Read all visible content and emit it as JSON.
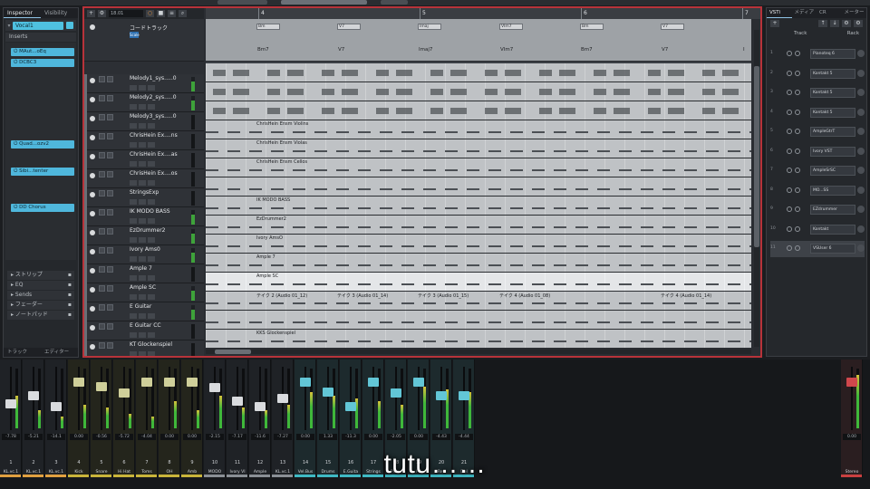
{
  "inspector": {
    "tabs": [
      "Inspector",
      "Visibility"
    ],
    "track_name": "Vocal1",
    "inserts_label": "Inserts",
    "inserts": [
      "MAut...oEq",
      "DCBC3",
      "Quad...ozv2",
      "Sibi...tenter",
      "DD Chorus"
    ],
    "sections": [
      "ストリップ",
      "EQ",
      "Sends",
      "フェーダー",
      "ノートパッド"
    ],
    "footer_tabs": [
      "トラック",
      "エディター"
    ]
  },
  "toolbar": {
    "position_display": "18.01"
  },
  "ruler": {
    "bars": [
      "4",
      "5",
      "6",
      "7"
    ]
  },
  "chord_track": {
    "name": "コードトラック",
    "tag": "Scale",
    "events": [
      "Bm7",
      "V7",
      "Imaj7",
      "VIm7",
      "Bm7",
      "V7",
      "I"
    ],
    "boxes": [
      "Bm",
      "V7",
      "Imaj",
      "VIm7",
      "Bm",
      "V7"
    ]
  },
  "tracks": [
    {
      "name": "Melody1_sys.....0",
      "color": "#6a6f76",
      "kind": "wave",
      "meter": true
    },
    {
      "name": "Melody2_sys.....0",
      "color": "#6a6f76",
      "kind": "wave",
      "meter": true
    },
    {
      "name": "Melody3_sys.....0",
      "color": "#6a6f76",
      "kind": "wave",
      "meter": false
    },
    {
      "name": "ChrisHein Ex....ns",
      "color": "#6a6f76",
      "kind": "midi",
      "region": "ChrisHein Ensm Violins",
      "meter": false
    },
    {
      "name": "ChrisHein Ex....as",
      "color": "#6a6f76",
      "kind": "midi",
      "region": "ChrisHein Ensm Violas",
      "meter": false
    },
    {
      "name": "ChrisHein Ex....os",
      "color": "#6a6f76",
      "kind": "midi",
      "region": "ChrisHein Ensm Cellos",
      "meter": false
    },
    {
      "name": "StringsExp",
      "color": "#6a6f76",
      "kind": "midi",
      "region": "",
      "meter": false
    },
    {
      "name": "IK MODO BASS",
      "color": "#6a6f76",
      "kind": "midi",
      "region": "IK MODO BASS",
      "meter": true
    },
    {
      "name": "EzDrummer2",
      "color": "#6a6f76",
      "kind": "midi",
      "region": "EzDrummer2",
      "meter": true
    },
    {
      "name": "Ivory Ams0",
      "color": "#6a6f76",
      "kind": "midi",
      "region": "Ivory AmsO",
      "meter": true
    },
    {
      "name": "Ample 7",
      "color": "#6a6f76",
      "kind": "midi",
      "region": "Ample 7",
      "meter": false
    },
    {
      "name": "Ample SC",
      "color": "#6a6f76",
      "kind": "midi",
      "region": "Ample SC",
      "meter": true,
      "selected": true
    },
    {
      "name": "E Guitar",
      "color": "#6a6f76",
      "kind": "takes",
      "meter": true
    },
    {
      "name": "E Guitar CC",
      "color": "#6a6f76",
      "kind": "midi",
      "region": "",
      "meter": false
    },
    {
      "name": "KT Glockenspiel",
      "color": "#6a6f76",
      "kind": "midi",
      "region": "KKS Glockenspiel",
      "meter": false
    }
  ],
  "takes": [
    "テイク 2 (Audio 01_12)",
    "テイク 3 (Audio 01_14)",
    "テイク 3 (Audio 01_15)",
    "テイク 4 (Audio 01_08)",
    "テイク 4 (Audio 01_14)"
  ],
  "rack": {
    "tabs": [
      "VSTi",
      "メディア",
      "CR",
      "メーター"
    ],
    "col_track": "Track",
    "col_rack": "Rack",
    "slots": [
      "Pianoteq 6",
      "Kontakt 5",
      "Kontakt 5",
      "Kontakt 5",
      "AmpleGtrT",
      "Ivory VST",
      "AmpleSrSC",
      "MO...SS",
      "EZdrummer",
      "Kontakt",
      "VSUser 6"
    ]
  },
  "mixer": {
    "strips": [
      {
        "num": "1",
        "label": "KL.vc.1",
        "val": "-7.78",
        "color": "#6b7077",
        "fader": 0.4,
        "level": 0.55,
        "foot": "#e0a040"
      },
      {
        "num": "2",
        "label": "KL.vc.1",
        "val": "-5.21",
        "color": "#6b7077",
        "fader": 0.55,
        "level": 0.3,
        "foot": "#e0a040"
      },
      {
        "num": "3",
        "label": "KL.vc.1",
        "val": "-14.1",
        "color": "#6b7077",
        "fader": 0.35,
        "level": 0.2,
        "foot": "#e0a040"
      },
      {
        "num": "4",
        "label": "Kick",
        "val": "0.00",
        "color": "#7a7b42",
        "fader": 0.8,
        "level": 0.4,
        "foot": "#c9b43a"
      },
      {
        "num": "5",
        "label": "Snare",
        "val": "-0.56",
        "color": "#7a7b42",
        "fader": 0.72,
        "level": 0.35,
        "foot": "#c9b43a"
      },
      {
        "num": "6",
        "label": "Hi Hat",
        "val": "-5.72",
        "color": "#7a7b42",
        "fader": 0.6,
        "level": 0.25,
        "foot": "#c9b43a"
      },
      {
        "num": "7",
        "label": "Toms",
        "val": "-4.04",
        "color": "#7a7b42",
        "fader": 0.8,
        "level": 0.2,
        "foot": "#c9b43a"
      },
      {
        "num": "8",
        "label": "OH",
        "val": "0.00",
        "color": "#7a7b42",
        "fader": 0.8,
        "level": 0.45,
        "foot": "#c9b43a"
      },
      {
        "num": "9",
        "label": "Amb",
        "val": "0.00",
        "color": "#7a7b42",
        "fader": 0.8,
        "level": 0.3,
        "foot": "#c9b43a"
      },
      {
        "num": "10",
        "label": "MODO",
        "val": "-2.15",
        "color": "#6b7077",
        "fader": 0.7,
        "level": 0.55,
        "foot": "#8a8f95"
      },
      {
        "num": "11",
        "label": "Ivory VI",
        "val": "-7.17",
        "color": "#6b7077",
        "fader": 0.45,
        "level": 0.35,
        "foot": "#8a8f95"
      },
      {
        "num": "12",
        "label": "Ample",
        "val": "-11.6",
        "color": "#6b7077",
        "fader": 0.35,
        "level": 0.3,
        "foot": "#8a8f95"
      },
      {
        "num": "13",
        "label": "KL.vc.1",
        "val": "-7.27",
        "color": "#6b7077",
        "fader": 0.5,
        "level": 0.4,
        "foot": "#8a8f95"
      },
      {
        "num": "14",
        "label": "Vel.Bus",
        "val": "0.00",
        "color": "#3a7c86",
        "fader": 0.8,
        "level": 0.6,
        "foot": "#3fb9c4"
      },
      {
        "num": "15",
        "label": "Drums",
        "val": "1.33",
        "color": "#3a7c86",
        "fader": 0.62,
        "level": 0.55,
        "foot": "#3fb9c4"
      },
      {
        "num": "16",
        "label": "E.Guita",
        "val": "-11.3",
        "color": "#3a7c86",
        "fader": 0.35,
        "level": 0.5,
        "foot": "#3fb9c4"
      },
      {
        "num": "17",
        "label": "Strings",
        "val": "0.00",
        "color": "#3a7c86",
        "fader": 0.8,
        "level": 0.45,
        "foot": "#3fb9c4"
      },
      {
        "num": "18",
        "label": "Piano",
        "val": "-2.05",
        "color": "#3a7c86",
        "fader": 0.6,
        "level": 0.4,
        "foot": "#3fb9c4"
      },
      {
        "num": "19",
        "label": "FX",
        "val": "0.00",
        "color": "#3a7c86",
        "fader": 0.8,
        "level": 0.7,
        "foot": "#3fb9c4"
      },
      {
        "num": "20",
        "label": "Rev",
        "val": "-4.43",
        "color": "#3a7c86",
        "fader": 0.55,
        "level": 0.65,
        "foot": "#3fb9c4"
      },
      {
        "num": "21",
        "label": "Del",
        "val": "-4.44",
        "color": "#3a7c86",
        "fader": 0.55,
        "level": 0.6,
        "foot": "#3fb9c4"
      }
    ],
    "master": {
      "label": "Stereo",
      "val": "0.00",
      "color": "#8a2a2e",
      "fader": 0.8,
      "level": 0.9,
      "foot": "#c94040"
    }
  },
  "subtitle": "tutu……"
}
